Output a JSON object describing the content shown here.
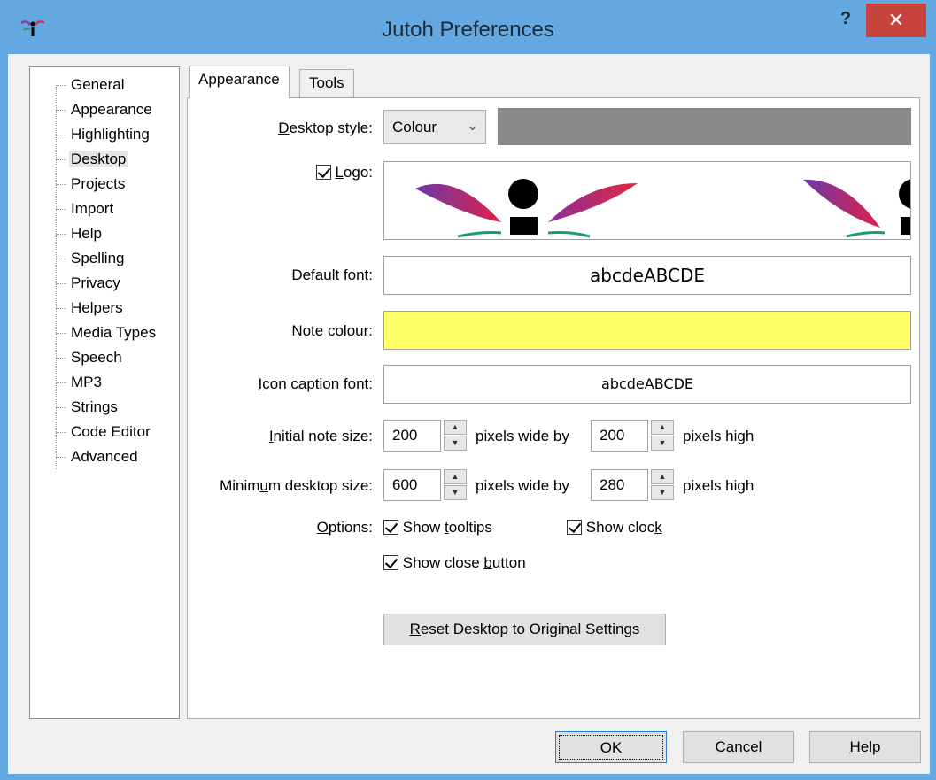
{
  "window": {
    "title": "Jutoh Preferences",
    "help_label": "?",
    "close_label": "✕"
  },
  "tree": {
    "items": [
      "General",
      "Appearance",
      "Highlighting",
      "Desktop",
      "Projects",
      "Import",
      "Help",
      "Spelling",
      "Privacy",
      "Helpers",
      "Media Types",
      "Speech",
      "MP3",
      "Strings",
      "Code Editor",
      "Advanced"
    ],
    "selected": "Desktop"
  },
  "tabs": [
    "Appearance",
    "Tools"
  ],
  "desktop": {
    "style_label_u": "D",
    "style_label_rest": "esktop style:",
    "style_value": "Colour",
    "logo_label_u": "L",
    "logo_label_rest": "ogo:",
    "default_font_label": "Default font:",
    "default_font_sample": "abcdeABCDE",
    "note_colour_label": "Note colour:",
    "icon_caption_label_u": "I",
    "icon_caption_label_rest": "con caption font:",
    "icon_caption_sample": "abcdeABCDE",
    "initial_note_label_u": "I",
    "initial_note_label_rest": "nitial note size:",
    "initial_width": "200",
    "initial_height": "200",
    "min_desktop_label_pre": "Minim",
    "min_desktop_label_u": "u",
    "min_desktop_label_rest": "m desktop size:",
    "min_width": "600",
    "min_height": "280",
    "pixels_wide_by": "pixels wide by",
    "pixels_high": "pixels high",
    "options_label_u": "O",
    "options_label_rest": "ptions:",
    "show_tooltips_pre": "Show ",
    "show_tooltips_u": "t",
    "show_tooltips_rest": "ooltips",
    "show_clock_pre": "Show cloc",
    "show_clock_u": "k",
    "show_close_pre": "Show close ",
    "show_close_u": "b",
    "show_close_rest": "utton",
    "reset_u": "R",
    "reset_rest": "eset Desktop to Original Settings"
  },
  "footer": {
    "ok": "OK",
    "cancel": "Cancel",
    "help_u": "H",
    "help_rest": "elp"
  },
  "colors": {
    "title_bar": "#63a8e0",
    "close": "#c7443d",
    "desktop_colour": "#8a8a8a",
    "note_colour": "#ffff66"
  }
}
